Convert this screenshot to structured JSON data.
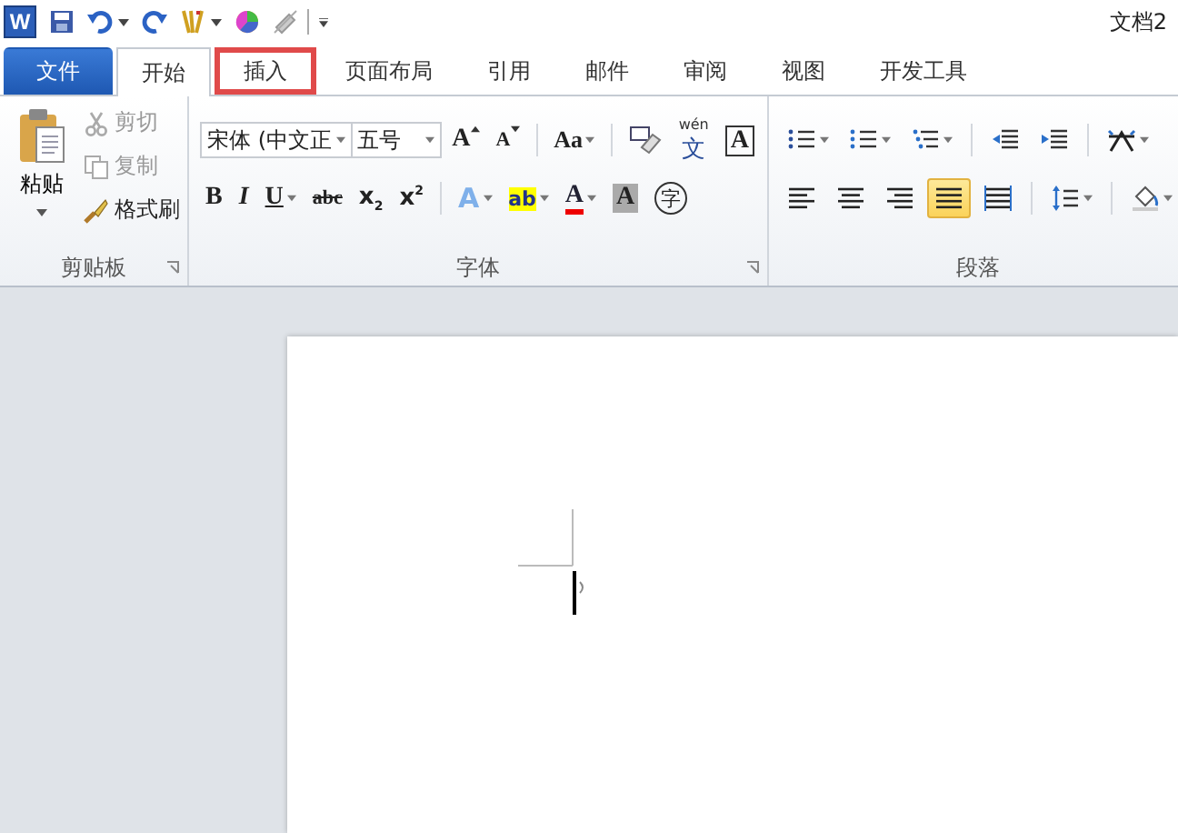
{
  "title_bar": {
    "app_icon_label": "W",
    "document_title": "文档2"
  },
  "tabs": [
    {
      "label": "文件",
      "kind": "file",
      "selected": false,
      "highlighted": false
    },
    {
      "label": "开始",
      "kind": "tab",
      "selected": true,
      "highlighted": false
    },
    {
      "label": "插入",
      "kind": "tab",
      "selected": false,
      "highlighted": true
    },
    {
      "label": "页面布局",
      "kind": "tab",
      "selected": false,
      "highlighted": false
    },
    {
      "label": "引用",
      "kind": "tab",
      "selected": false,
      "highlighted": false
    },
    {
      "label": "邮件",
      "kind": "tab",
      "selected": false,
      "highlighted": false
    },
    {
      "label": "审阅",
      "kind": "tab",
      "selected": false,
      "highlighted": false
    },
    {
      "label": "视图",
      "kind": "tab",
      "selected": false,
      "highlighted": false
    },
    {
      "label": "开发工具",
      "kind": "tab",
      "selected": false,
      "highlighted": false
    }
  ],
  "clipboard": {
    "paste_label": "粘贴",
    "group_label": "剪贴板",
    "items": [
      {
        "label": "剪切",
        "kind": "cut",
        "disabled": true
      },
      {
        "label": "复制",
        "kind": "copy",
        "disabled": true
      },
      {
        "label": "格式刷",
        "kind": "painter",
        "disabled": false
      }
    ]
  },
  "font": {
    "font_name": "宋体 (中文正",
    "font_size": "五号",
    "group_label": "字体",
    "row_1": [
      {
        "label": "A",
        "kind": "grow"
      },
      {
        "label": "A",
        "kind": "shrink"
      },
      {
        "label": "Aa",
        "kind": "case"
      },
      {
        "kind": "clear"
      },
      {
        "label": "文",
        "kind": "phonetic",
        "top": "wén"
      },
      {
        "label": "A",
        "kind": "border"
      }
    ],
    "row_2": [
      {
        "label": "B",
        "kind": "bold"
      },
      {
        "label": "I",
        "kind": "italic"
      },
      {
        "label": "U",
        "kind": "underline"
      },
      {
        "label": "abc",
        "kind": "strike"
      },
      {
        "label": "x",
        "kind": "sub",
        "script": "2"
      },
      {
        "label": "x",
        "kind": "sup",
        "script": "2"
      },
      {
        "label": "A",
        "kind": "effect"
      },
      {
        "label": "ab",
        "kind": "highlight"
      },
      {
        "label": "A",
        "kind": "color"
      },
      {
        "label": "A",
        "kind": "shade"
      },
      {
        "label": "字",
        "kind": "enclose"
      }
    ]
  },
  "paragraph": {
    "group_label": "段落",
    "row_1": [
      {
        "kind": "bullets",
        "selected": false
      },
      {
        "kind": "numbering",
        "selected": false
      },
      {
        "kind": "multilevel",
        "selected": false
      },
      {
        "kind": "outdent",
        "selected": false
      },
      {
        "kind": "indent",
        "selected": false
      },
      {
        "kind": "asian",
        "selected": false
      }
    ],
    "row_2": [
      {
        "kind": "left",
        "selected": false
      },
      {
        "kind": "center",
        "selected": false
      },
      {
        "kind": "right",
        "selected": false
      },
      {
        "kind": "justify",
        "selected": true
      },
      {
        "kind": "distributed",
        "selected": false
      },
      {
        "kind": "spacing",
        "selected": false
      },
      {
        "kind": "fill",
        "selected": false
      }
    ]
  }
}
